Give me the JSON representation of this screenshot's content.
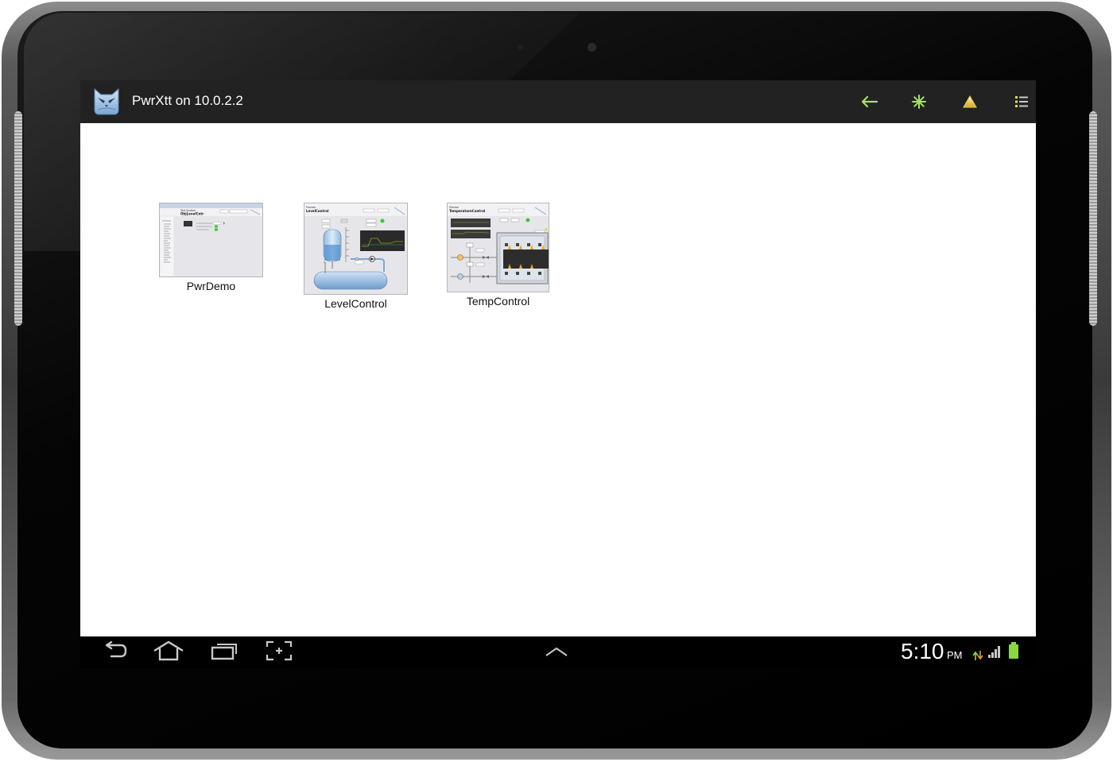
{
  "app": {
    "title": "PwrXtt on 10.0.2.2",
    "icon": "owl-icon"
  },
  "actionbar": {
    "buttons": [
      {
        "name": "back-arrow-icon",
        "color": "#a8e060"
      },
      {
        "name": "star-icon",
        "color": "#a8e060"
      },
      {
        "name": "alarm-triangle-icon",
        "color": "#e8d060"
      },
      {
        "name": "list-icon",
        "color": "#e8d060"
      }
    ]
  },
  "graphs": [
    {
      "label": "PwrDemo",
      "thumb": {
        "header_top": "Test System",
        "header_bottom": "ObjLevelCntr"
      }
    },
    {
      "label": "LevelControl",
      "thumb": {
        "header_top": "Process",
        "header_bottom": "LevelControl"
      }
    },
    {
      "label": "TempControl",
      "thumb": {
        "header_top": "Process",
        "header_bottom": "TemperatureControl"
      }
    }
  ],
  "system_bar": {
    "nav_icons": [
      "back-icon",
      "home-icon",
      "recent-apps-icon",
      "screenshot-icon",
      "chevron-up-icon"
    ],
    "time": "5:10",
    "ampm": "PM",
    "status_icons": [
      "data-transfer-icon",
      "signal-icon",
      "battery-icon"
    ],
    "accent": "#8ad840"
  }
}
